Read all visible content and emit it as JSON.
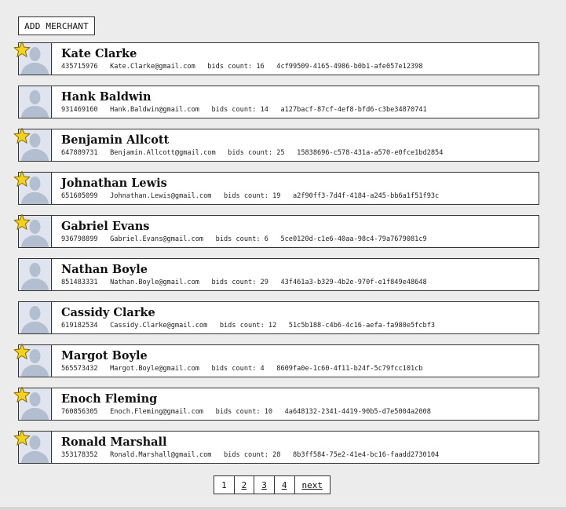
{
  "add_button_label": "ADD MERCHANT",
  "colors": {
    "star_fill": "#f3d21b",
    "star_stroke": "#8a6a00",
    "avatar_bg": "#dfe4ee",
    "avatar_silhouette": "#b4bed1"
  },
  "merchants": [
    {
      "name": "Kate Clarke",
      "phone": "435715976",
      "email": "Kate.Clarke@gmail.com",
      "bids": "bids count: 16",
      "id": "4cf99509-4165-4986-b0b1-afe057e12398",
      "starred": true
    },
    {
      "name": "Hank Baldwin",
      "phone": "931469160",
      "email": "Hank.Baldwin@gmail.com",
      "bids": "bids count: 14",
      "id": "a127bacf-87cf-4ef8-bfd6-c3be34870741",
      "starred": false
    },
    {
      "name": "Benjamin Allcott",
      "phone": "647889731",
      "email": "Benjamin.Allcott@gmail.com",
      "bids": "bids count: 25",
      "id": "15838696-c578-431a-a570-e0fce1bd2854",
      "starred": true
    },
    {
      "name": "Johnathan Lewis",
      "phone": "651605099",
      "email": "Johnathan.Lewis@gmail.com",
      "bids": "bids count: 19",
      "id": "a2f90ff3-7d4f-4184-a245-bb6a1f51f93c",
      "starred": true
    },
    {
      "name": "Gabriel Evans",
      "phone": "936798899",
      "email": "Gabriel.Evans@gmail.com",
      "bids": "bids count: 6",
      "id": "5ce0120d-c1e6-40aa-98c4-79a7679081c9",
      "starred": true
    },
    {
      "name": "Nathan Boyle",
      "phone": "851483331",
      "email": "Nathan.Boyle@gmail.com",
      "bids": "bids count: 29",
      "id": "43f461a3-b329-4b2e-970f-e1f849e48648",
      "starred": false
    },
    {
      "name": "Cassidy Clarke",
      "phone": "619182534",
      "email": "Cassidy.Clarke@gmail.com",
      "bids": "bids count: 12",
      "id": "51c5b188-c4b6-4c16-aefa-fa980e5fcbf3",
      "starred": false
    },
    {
      "name": "Margot Boyle",
      "phone": "565573432",
      "email": "Margot.Boyle@gmail.com",
      "bids": "bids count: 4",
      "id": "8609fa0e-1c60-4f11-b24f-5c79fcc101cb",
      "starred": true
    },
    {
      "name": "Enoch Fleming",
      "phone": "760856305",
      "email": "Enoch.Fleming@gmail.com",
      "bids": "bids count: 10",
      "id": "4a648132-2341-4419-90b5-d7e5004a2008",
      "starred": true
    },
    {
      "name": "Ronald Marshall",
      "phone": "353178352",
      "email": "Ronald.Marshall@gmail.com",
      "bids": "bids count: 28",
      "id": "8b3ff584-75e2-41e4-bc16-faadd2730104",
      "starred": true
    }
  ],
  "pagination": {
    "current": "1",
    "pages": [
      "1",
      "2",
      "3",
      "4"
    ],
    "next_label": "next"
  }
}
